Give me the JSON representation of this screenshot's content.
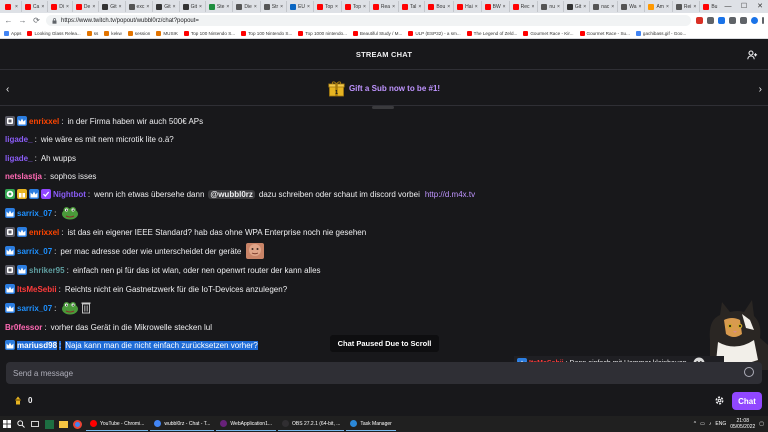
{
  "browser": {
    "tabs": [
      {
        "label": "",
        "color": "#ff0000"
      },
      {
        "label": "Ca",
        "color": "#ff0000"
      },
      {
        "label": "Di",
        "color": "#ff0000"
      },
      {
        "label": "De",
        "color": "#ff0000"
      },
      {
        "label": "Git",
        "color": "#333333"
      },
      {
        "label": "exc",
        "color": "#555555"
      },
      {
        "label": "Git",
        "color": "#333333"
      },
      {
        "label": "Git",
        "color": "#333333"
      },
      {
        "label": "Ste",
        "color": "#1e8e3e"
      },
      {
        "label": "Die",
        "color": "#555555"
      },
      {
        "label": "Str",
        "color": "#555555"
      },
      {
        "label": "EU",
        "color": "#0a66c2"
      },
      {
        "label": "Top",
        "color": "#ff0000"
      },
      {
        "label": "Top",
        "color": "#ff0000"
      },
      {
        "label": "Rea",
        "color": "#ff0000"
      },
      {
        "label": "Tal",
        "color": "#ff0000"
      },
      {
        "label": "Bou",
        "color": "#ff0000"
      },
      {
        "label": "Hai",
        "color": "#ff0000"
      },
      {
        "label": "BW",
        "color": "#ff0000"
      },
      {
        "label": "Rec",
        "color": "#ff0000"
      },
      {
        "label": "nu",
        "color": "#555555"
      },
      {
        "label": "Git",
        "color": "#333333"
      },
      {
        "label": "nac",
        "color": "#555555"
      },
      {
        "label": "Wa",
        "color": "#555555"
      },
      {
        "label": "Am",
        "color": "#ff9900"
      },
      {
        "label": "Rei",
        "color": "#555555"
      },
      {
        "label": "Bu",
        "color": "#ff0000"
      },
      {
        "label": "nuc",
        "color": "#555555"
      },
      {
        "label": "Ru",
        "color": "#555555"
      },
      {
        "label": "gpl",
        "color": "#555555"
      }
    ],
    "new_tab": "+",
    "window_controls": [
      "—",
      "☐",
      "✕"
    ],
    "nav": {
      "back": "←",
      "forward": "→",
      "reload": "⟳"
    },
    "url": "https://www.twitch.tv/popout/wubbl0rz/chat?popout=",
    "bookmarks": [
      {
        "label": "Apps",
        "color": "#4285f4"
      },
      {
        "label": "Looking Glass Relea...",
        "color": "#ff0000"
      },
      {
        "label": "ss",
        "color": "#e37400"
      },
      {
        "label": "kekw",
        "color": "#e37400"
      },
      {
        "label": "session",
        "color": "#e37400"
      },
      {
        "label": "MUSIK",
        "color": "#e37400"
      },
      {
        "label": "Top 100 Nintendo S...",
        "color": "#ff0000"
      },
      {
        "label": "Top 100 Nintendo S...",
        "color": "#ff0000"
      },
      {
        "label": "Top 1000 nintendo...",
        "color": "#ff0000"
      },
      {
        "label": "Beautiful Study / M...",
        "color": "#ff0000"
      },
      {
        "label": "ULP (ESP32) - a sm...",
        "color": "#ff0000"
      },
      {
        "label": "The Legend of Zeld...",
        "color": "#ff0000"
      },
      {
        "label": "Gourmet Race - Kir...",
        "color": "#ff0000"
      },
      {
        "label": "Gourmet Race - Su...",
        "color": "#ff0000"
      },
      {
        "label": "gachibass.gif - Goo...",
        "color": "#4285f4"
      }
    ]
  },
  "chat": {
    "header_title": "STREAM CHAT",
    "gift_text": "Gift a Sub now to be #1!",
    "paused_text": "Chat Paused Due to Scroll",
    "input_placeholder": "Send a message",
    "points": "0",
    "chat_button": "Chat",
    "messages": [
      {
        "badges": [
          "mod",
          "sub"
        ],
        "user": "enrixxel",
        "color": "#ff4500",
        "sep": ":",
        "text": "in der Firma haben wir auch 500€ APs"
      },
      {
        "badges": [],
        "user": "ligade_",
        "color": "#8a5cf6",
        "sep": ":",
        "text": "wie wäre es mit nem microtik lite o.ä?"
      },
      {
        "badges": [],
        "user": "ligade_",
        "color": "#8a5cf6",
        "sep": ":",
        "text": "Ah wupps"
      },
      {
        "badges": [],
        "user": "netslastja",
        "color": "#ff69b4",
        "sep": ":",
        "text": "sophos isses"
      },
      {
        "badges": [
          "bot",
          "gift",
          "sub",
          "verified"
        ],
        "user": "Nightbot",
        "color": "#8a5cf6",
        "sep": ":",
        "text": "wenn ich etwas übersehe dann",
        "mention": "@wubbl0rz",
        "text2": "dazu schreiben oder schaut im discord vorbei",
        "link": "http://d.m4x.tv"
      },
      {
        "badges": [
          "sub"
        ],
        "user": "sarrix_07",
        "color": "#1e90ff",
        "sep": ":",
        "text": "",
        "emote": "frog"
      },
      {
        "badges": [
          "mod",
          "sub"
        ],
        "user": "enrixxel",
        "color": "#ff4500",
        "sep": ":",
        "text": "ist das ein eigener IEEE Standard? hab das ohne WPA Enterprise noch nie gesehen"
      },
      {
        "badges": [
          "sub"
        ],
        "user": "sarrix_07",
        "color": "#1e90ff",
        "sep": ":",
        "text": "per mac adresse oder wie unterscheidet der geräte",
        "emote": "face"
      },
      {
        "badges": [
          "mod",
          "sub"
        ],
        "user": "shriker95",
        "color": "#5f9ea0",
        "sep": ":",
        "text": "einfach nen pi für das iot wlan, oder nen openwrt router der kann alles"
      },
      {
        "badges": [
          "sub"
        ],
        "user": "ItsMeSebii",
        "color": "#ff3b3b",
        "sep": ":",
        "text": "Reichts nicht ein Gastnetzwerk für die IoT-Devices anzulegen?"
      },
      {
        "badges": [
          "sub"
        ],
        "user": "sarrix_07",
        "color": "#1e90ff",
        "sep": ":",
        "text": "",
        "emote": "frog-trash"
      },
      {
        "badges": [],
        "user": "Br0fessor",
        "color": "#ff69b4",
        "sep": ":",
        "text": "vorher das Gerät in die Mikrowelle stecken lul"
      },
      {
        "badges": [
          "sub"
        ],
        "user": "mariusd98",
        "color": "#ffffff",
        "sep": ":",
        "text": "Naja kann man die nicht einfach zurücksetzen vorher?",
        "selected": true
      }
    ],
    "notice": {
      "user": "ItsMeSebii",
      "color": "#ff3b3b",
      "text": ": Dann einfach mit Hammer kleinhauen"
    }
  },
  "taskbar": {
    "apps": [
      {
        "label": "YouTube - Chromi...",
        "color": "#ff0000"
      },
      {
        "label": "wubbl0rz - Chat - T...",
        "color": "#4285f4"
      },
      {
        "label": "WebApplication1...",
        "color": "#68217a"
      },
      {
        "label": "OBS 27.2.1 (64-bit, ...",
        "color": "#302e31"
      },
      {
        "label": "Task Manager",
        "color": "#2b88d8"
      }
    ],
    "lang": "ENG",
    "time": "21:08",
    "date": "05/05/2022"
  },
  "colors": {
    "accent": "#9147ff",
    "gift": "#bf94ff",
    "background": "#18181b"
  }
}
